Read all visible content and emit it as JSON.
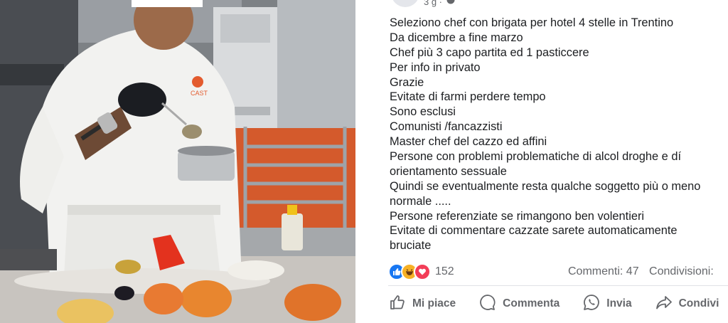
{
  "post": {
    "timestamp_fragment": "3 g ·",
    "lines": [
      "Seleziono chef con brigata per hotel 4 stelle in Trentino",
      "Da dicembre a fine marzo",
      "Chef più 3 capo partita ed 1 pasticcere",
      "Per info in privato",
      "Grazie",
      "Evitate di farmi perdere tempo",
      "Sono esclusi",
      "Comunisti /fancazzisti",
      "Master chef del cazzo ed affini",
      "Persone con problemi problematiche di alcol droghe e dí",
      "orientamento sessuale",
      "Quindi se eventualmente resta qualche soggetto più o meno",
      "normale .....",
      "Persone referenziate se rimangono ben volentieri",
      "Evitate di commentare cazzate sarete automaticamente",
      "bruciate"
    ]
  },
  "reactions": {
    "icons": [
      "like-icon",
      "haha-icon",
      "love-icon"
    ],
    "count": "152",
    "comments": "Commenti: 47",
    "shares": "Condivisioni:"
  },
  "actions": {
    "like": "Mi piace",
    "comment": "Commenta",
    "send": "Invia",
    "share": "Condivi"
  },
  "photo": {
    "jacket_logo_text": "CAST"
  },
  "colors": {
    "like_blue": "#1877f2",
    "love_red": "#f33e58",
    "haha_yellow": "#f7b125",
    "muted_text": "#65676b"
  }
}
